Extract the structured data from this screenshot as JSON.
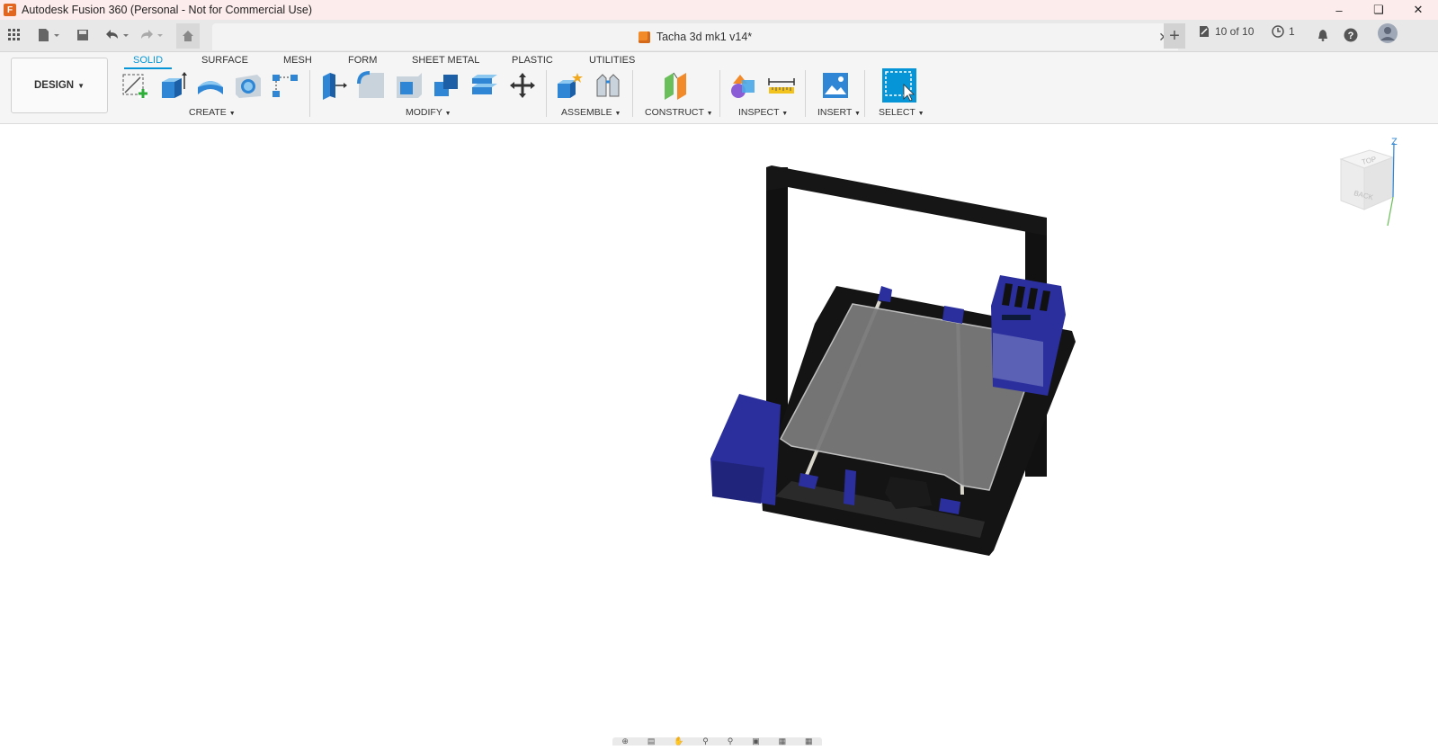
{
  "titlebar": {
    "title": "Autodesk Fusion 360 (Personal - Not for Commercial Use)",
    "controls": [
      "minimize-icon",
      "restore-icon",
      "close-icon"
    ]
  },
  "quickaccess": {
    "items": [
      "apps-grid-icon",
      "file-icon",
      "save-icon",
      "undo-icon",
      "redo-icon",
      "home-icon"
    ],
    "document_title": "Tacha 3d mk1 v14*",
    "version_count": "10 of 10",
    "job_count": "1"
  },
  "ribbon": {
    "workspace": "DESIGN",
    "tabs": [
      {
        "label": "SOLID",
        "active": true
      },
      {
        "label": "SURFACE",
        "active": false
      },
      {
        "label": "MESH",
        "active": false
      },
      {
        "label": "FORM",
        "active": false
      },
      {
        "label": "SHEET METAL",
        "active": false
      },
      {
        "label": "PLASTIC",
        "active": false
      },
      {
        "label": "UTILITIES",
        "active": false
      }
    ],
    "groups": {
      "create": "CREATE",
      "modify": "MODIFY",
      "assemble": "ASSEMBLE",
      "construct": "CONSTRUCT",
      "inspect": "INSPECT",
      "insert": "INSERT",
      "select": "SELECT"
    }
  },
  "viewcube": {
    "top": "TOP",
    "back": "BACK",
    "axis": "Z"
  },
  "colors": {
    "accent": "#0696d7",
    "frame": "#111111",
    "parts": "#2b2f9e",
    "bed": "#777777"
  }
}
